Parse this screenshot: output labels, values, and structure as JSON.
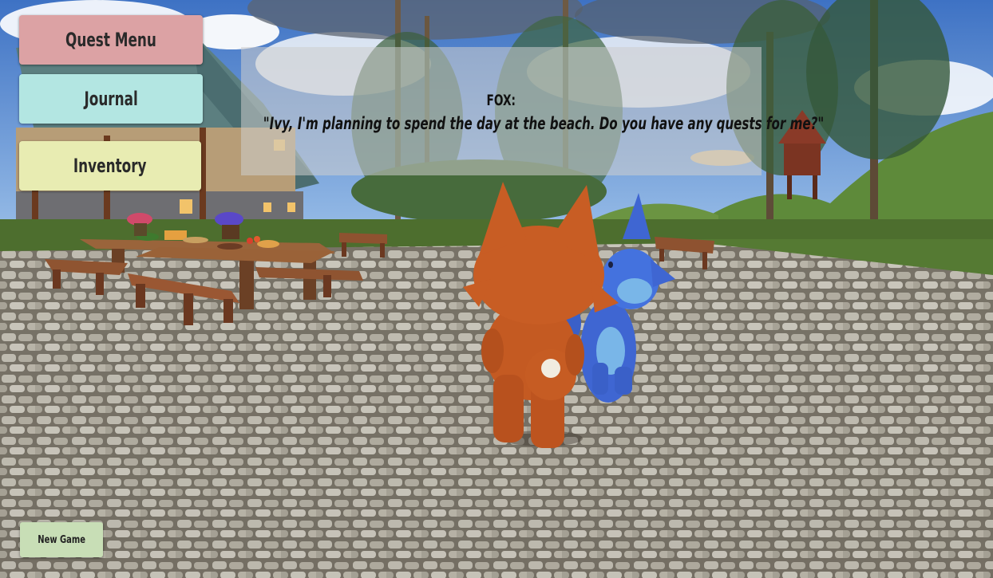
{
  "hud": {
    "quest_menu_label": "Quest Menu",
    "journal_label": "Journal",
    "inventory_label": "Inventory",
    "new_game_label": "New Game"
  },
  "dialogue": {
    "speaker": "FOX:",
    "line": "\"Ivy, I'm planning to spend the day at the beach. Do you have any quests for me?\""
  },
  "colors": {
    "quest_menu_bg": "#dca2a4",
    "journal_bg": "#b3e6e2",
    "inventory_bg": "#e8ecb2",
    "new_game_bg": "#c8deb6",
    "fox": "#c75a22",
    "blue_character": "#3f66d2"
  }
}
